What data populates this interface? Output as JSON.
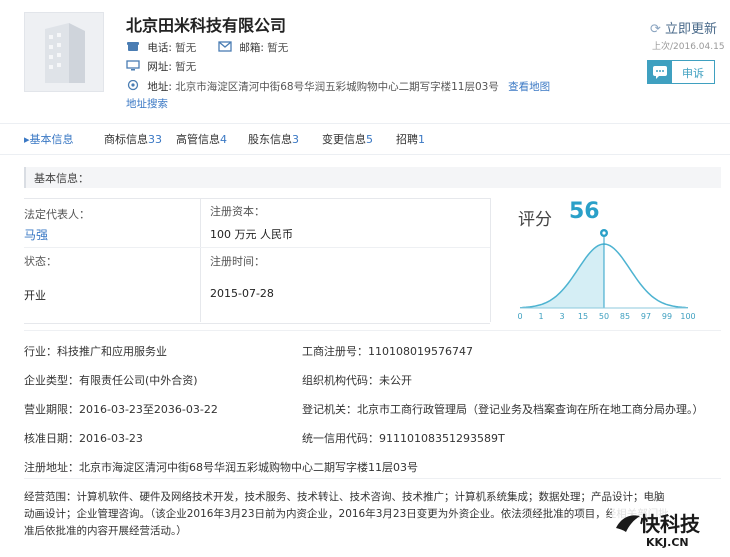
{
  "company": {
    "name": "北京田米科技有限公司",
    "phone_label": "电话:",
    "phone": "暂无",
    "email_label": "邮箱:",
    "email": "暂无",
    "website_label": "网址:",
    "website": "暂无",
    "address_label": "地址:",
    "address": "北京市海淀区清河中街68号华润五彩城购物中心二期写字楼11层03号",
    "view_map": "查看地图",
    "address_search": "地址搜索"
  },
  "actions": {
    "update": "立即更新",
    "last_update": "上次/2016.04.15",
    "complain": "申诉"
  },
  "tabs": [
    {
      "label": "基本信息",
      "count": ""
    },
    {
      "label": "商标信息",
      "count": "33"
    },
    {
      "label": "高管信息",
      "count": "4"
    },
    {
      "label": "股东信息",
      "count": "3"
    },
    {
      "label": "变更信息",
      "count": "5"
    },
    {
      "label": "招聘",
      "count": "1"
    }
  ],
  "section_title": "基本信息：",
  "summary": {
    "legal_rep_label": "法定代表人：",
    "legal_rep": "马强",
    "capital_label": "注册资本：",
    "capital": "100 万元 人民币",
    "status_label": "状态：",
    "status": "开业",
    "reg_time_label": "注册时间：",
    "reg_time": "2015-07-28"
  },
  "score": {
    "label": "评分",
    "value": 56,
    "axis_ticks": [
      "0",
      "1",
      "3",
      "15",
      "50",
      "85",
      "97",
      "99",
      "100"
    ],
    "marker_tick_index": 4,
    "accent": "#2aa0c8"
  },
  "details": {
    "industry_label": "行业：",
    "industry": "科技推广和应用服务业",
    "reg_no_label": "工商注册号：",
    "reg_no": "110108019576747",
    "type_label": "企业类型：",
    "type": "有限责任公司(中外合资)",
    "org_code_label": "组织机构代码：",
    "org_code": "未公开",
    "term_label": "营业期限：",
    "term": "2016-03-23至2036-03-22",
    "authority_label": "登记机关：",
    "authority": "北京市工商行政管理局（登记业务及档案查询在所在地工商分局办理。）",
    "approval_label": "核准日期：",
    "approval": "2016-03-23",
    "credit_label": "统一信用代码：",
    "credit": "91110108351293589T",
    "reg_addr_label": "注册地址：",
    "reg_addr": "北京市海淀区清河中街68号华润五彩城购物中心二期写字楼11层03号",
    "scope_label": "经营范围：",
    "scope_line1": "计算机软件、硬件及网络技术开发，技术服务、技术转让、技术咨询、技术推广；计算机系统集成；数据处理；产品设计；电脑",
    "scope_line2": "动画设计；企业管理咨询。（该企业2016年3月23日前为内资企业，2016年3月23日变更为外资企业。依法须经批准的项目，经相关部门批",
    "scope_line3": "准后依批准的内容开展经营活动。）"
  },
  "watermark": {
    "text": "快科技",
    "url": "KKJ.CN"
  }
}
